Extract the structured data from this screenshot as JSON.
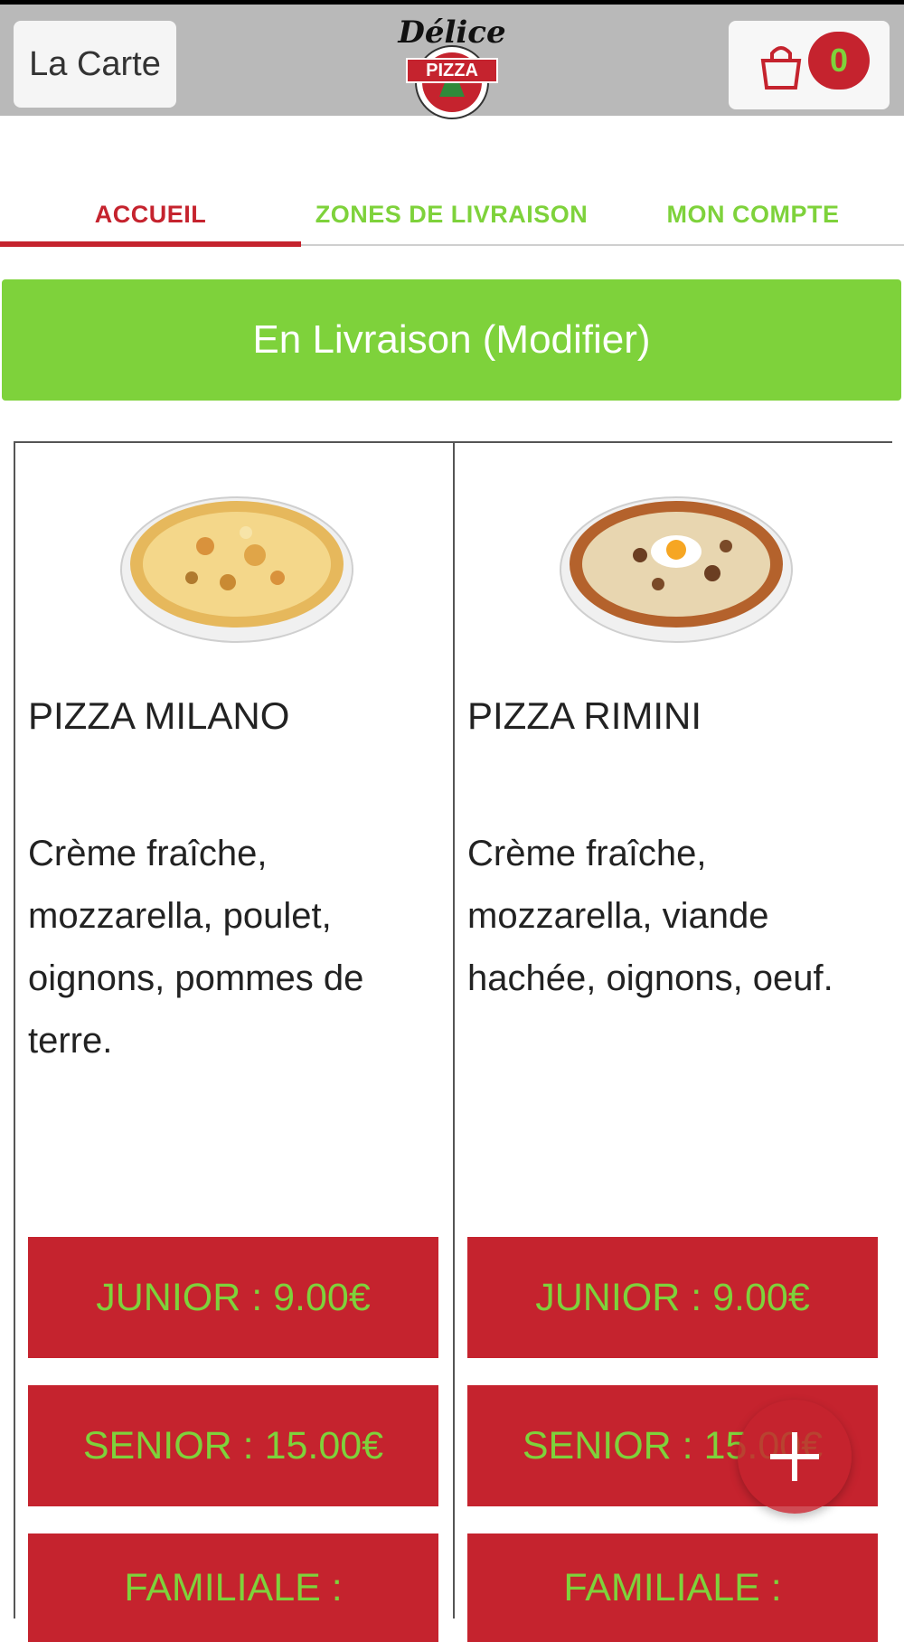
{
  "header": {
    "menu_button_label": "La Carte",
    "logo": {
      "top_text": "Délice",
      "main_text": "PIZZA",
      "icon": "pizza-logo"
    },
    "cart_count": "0",
    "cart_icon": "shopping-bag-icon"
  },
  "tabs": [
    {
      "label": "ACCUEIL",
      "active": true
    },
    {
      "label": "ZONES DE LIVRAISON",
      "active": false
    },
    {
      "label": "MON COMPTE",
      "active": false
    }
  ],
  "mode_button": "En Livraison (Modifier)",
  "products": [
    {
      "name": "PIZZA MILANO",
      "description": "Crème fraîche, mozzarella, poulet, oignons, pommes de terre.",
      "prices": [
        "JUNIOR : 9.00€",
        "SENIOR : 15.00€",
        "FAMILIALE :"
      ]
    },
    {
      "name": "PIZZA RIMINI",
      "description": "Crème fraîche, mozzarella, viande hachée, oignons, oeuf.",
      "prices": [
        "JUNIOR : 9.00€",
        "SENIOR : 15.00€",
        "FAMILIALE :"
      ]
    }
  ],
  "fab_icon": "plus-icon",
  "colors": {
    "brand_red": "#c5232e",
    "brand_green": "#7ed23b",
    "header_gray": "#b9b9b9"
  }
}
